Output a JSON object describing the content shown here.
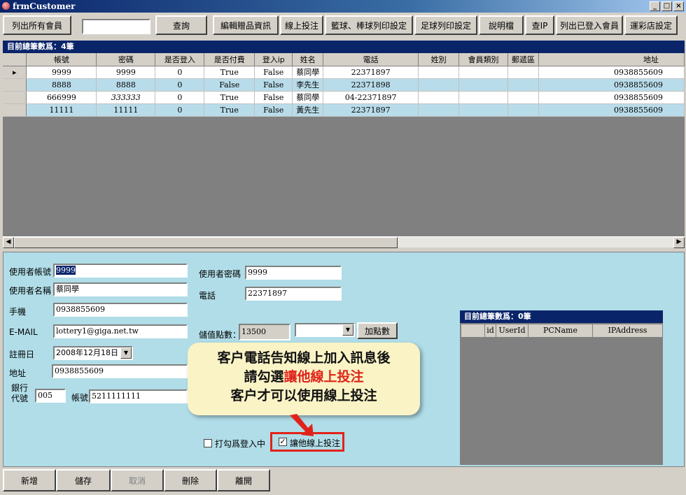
{
  "window": {
    "title": "frmCustomer",
    "minimize": "_",
    "maximize": "□",
    "close": "×"
  },
  "toolbar": {
    "list_all": "列出所有會員",
    "search_value": "",
    "query": "查詢",
    "edit_gift": "編輯贈品資訊",
    "online_bet": "線上投注",
    "basket_print": "籃球、棒球列印設定",
    "soccer_print": "足球列印設定",
    "manual": "說明檔",
    "check_ip": "查IP",
    "list_logged": "列出已登入會員",
    "lottery_setting": "運彩店設定"
  },
  "main_grid": {
    "caption": "目前總筆數爲：4筆",
    "columns": [
      "帳號",
      "密碼",
      "是否登入",
      "是否付費",
      "登入ip",
      "姓名",
      "電話",
      "姓別",
      "會員類別",
      "郵遞區",
      "地址"
    ],
    "rows": [
      [
        "9999",
        "9999",
        "0",
        "True",
        "False",
        "蔡同學",
        "22371897",
        "",
        "",
        "",
        "0938855609"
      ],
      [
        "8888",
        "8888",
        "0",
        "False",
        "False",
        "李先生",
        "22371898",
        "",
        "",
        "",
        "0938855609"
      ],
      [
        "666999",
        "333333",
        "0",
        "True",
        "False",
        "蔡同學",
        "04-22371897",
        "",
        "",
        "",
        "0938855609"
      ],
      [
        "11111",
        "11111",
        "0",
        "True",
        "False",
        "黃先生",
        "22371897",
        "",
        "",
        "",
        "0938855609"
      ]
    ],
    "current_row_marker": "▸"
  },
  "form": {
    "account_label": "使用者帳號",
    "account_value": "9999",
    "password_label": "使用者密碼",
    "password_value": "9999",
    "name_label": "使用者名稱",
    "name_value": "蔡同學",
    "phone_label": "電話",
    "phone_value": "22371897",
    "mobile_label": "手機",
    "mobile_value": "0938855609",
    "email_label": "E-MAIL",
    "email_value": "lottery1@giga.net.tw",
    "points_label": "儲值點數：",
    "points_value": "13500",
    "points_select": "",
    "add_points": "加點數",
    "register_label": "註冊日",
    "register_value": "2008年12月18日",
    "address_label": "地址",
    "address_value": "0938855609",
    "bank_label_1": "銀行",
    "bank_label_2": "代號",
    "bank_code": "005",
    "bank_account_label": "帳號",
    "bank_account_value": "5211111111",
    "logged_in_label": "打勾爲登入中",
    "allow_online_label": "讓他線上投注",
    "allow_online_check": "✓"
  },
  "callout": {
    "line1": "客户電話告知線上加入訊息後",
    "line2_prefix": "請勾選",
    "line2_highlight": "讓他線上投注",
    "line3": "客户才可以使用線上投注"
  },
  "login_grid": {
    "caption": "目前總筆數爲：0筆",
    "columns": [
      "id",
      "UserId",
      "PCName",
      "IPAddress"
    ]
  },
  "bottom": {
    "add": "新增",
    "save": "儲存",
    "cancel": "取消",
    "delete": "刪除",
    "leave": "離開"
  },
  "colors": {
    "accent": "#0a246a",
    "panel": "#b0dde8",
    "row_alt": "#b9dcea",
    "highlight": "#e0221a"
  }
}
